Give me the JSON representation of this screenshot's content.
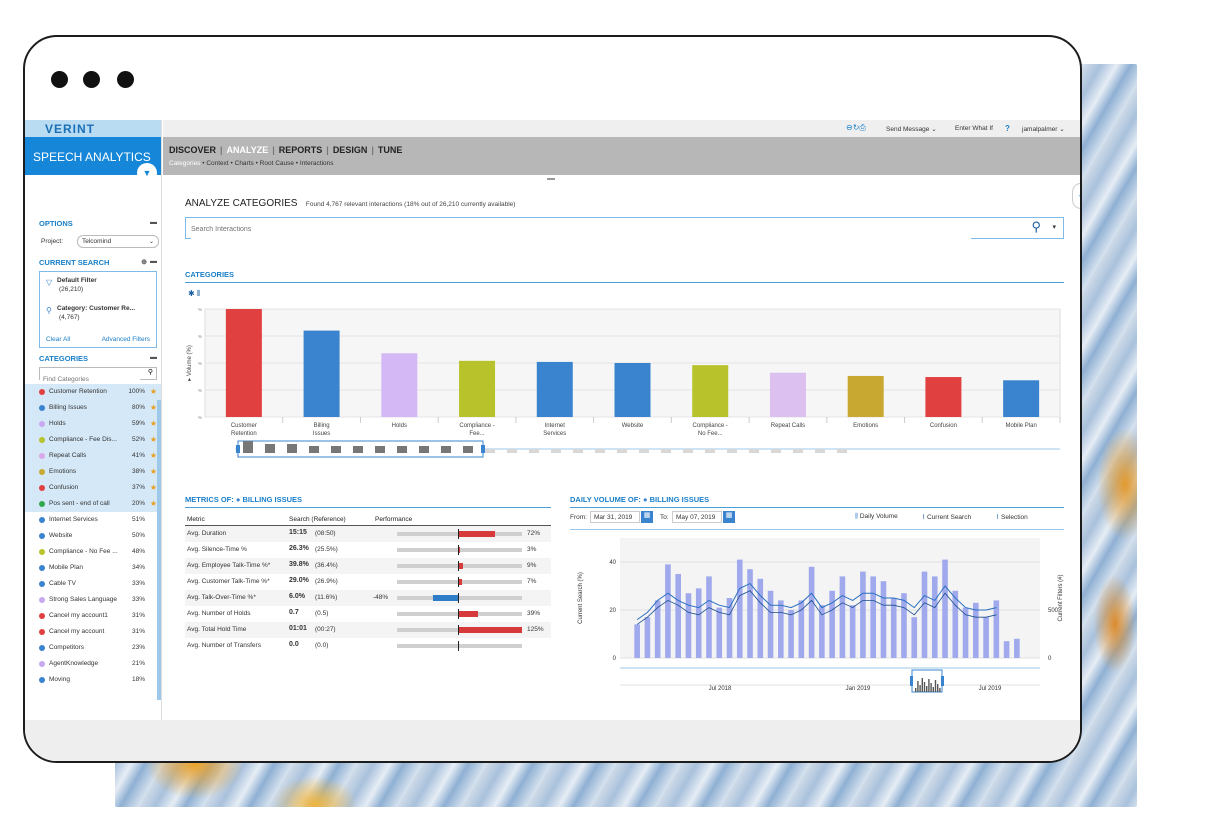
{
  "brand": "VERINT",
  "product": "SPEECH ANALYTICS",
  "topbar": {
    "send_message": "Send Message",
    "enter_what_if": "Enter What If",
    "help": "?",
    "user": "jamalpalmer"
  },
  "nav": {
    "tabs": [
      "DISCOVER",
      "ANALYZE",
      "REPORTS",
      "DESIGN",
      "TUNE"
    ],
    "active_tab": "ANALYZE",
    "subtabs": [
      "Categories",
      "Context",
      "Charts",
      "Root Cause",
      "Interactions"
    ],
    "active_subtab": "Categories"
  },
  "sidebar": {
    "options_title": "OPTIONS",
    "project_label": "Project:",
    "project_value": "Telcomind",
    "current_search_title": "CURRENT SEARCH",
    "filters": [
      {
        "label": "Default Filter",
        "count": "(26,210)"
      },
      {
        "label": "Category: Customer Re...",
        "count": "(4,767)"
      }
    ],
    "clear_all": "Clear All",
    "advanced_filters": "Advanced Filters",
    "categories_title": "CATEGORIES",
    "find_placeholder": "Find Categories",
    "categories": [
      {
        "name": "Customer Retention",
        "pct": "100%",
        "color": "#e04040",
        "selected": true
      },
      {
        "name": "Billing Issues",
        "pct": "80%",
        "color": "#3a84cf",
        "selected": true
      },
      {
        "name": "Holds",
        "pct": "59%",
        "color": "#c9a8f0",
        "selected": true
      },
      {
        "name": "Compliance - Fee Dis...",
        "pct": "52%",
        "color": "#b8c22a",
        "selected": true
      },
      {
        "name": "Repeat Calls",
        "pct": "41%",
        "color": "#d8a8e8",
        "selected": true
      },
      {
        "name": "Emotions",
        "pct": "38%",
        "color": "#c8a830",
        "selected": true
      },
      {
        "name": "Confusion",
        "pct": "37%",
        "color": "#e04040",
        "selected": true
      },
      {
        "name": "Pos sent - end of call",
        "pct": "20%",
        "color": "#2ea84a",
        "selected": true
      },
      {
        "name": "Internet Services",
        "pct": "51%",
        "color": "#3a84cf",
        "selected": false
      },
      {
        "name": "Website",
        "pct": "50%",
        "color": "#3a84cf",
        "selected": false
      },
      {
        "name": "Compliance - No Fee ...",
        "pct": "48%",
        "color": "#b8c22a",
        "selected": false
      },
      {
        "name": "Mobile Plan",
        "pct": "34%",
        "color": "#3a84cf",
        "selected": false
      },
      {
        "name": "Cable TV",
        "pct": "33%",
        "color": "#3a84cf",
        "selected": false
      },
      {
        "name": "Strong Sales Language",
        "pct": "33%",
        "color": "#c9a8f0",
        "selected": false
      },
      {
        "name": "Cancel my account1",
        "pct": "31%",
        "color": "#e04040",
        "selected": false
      },
      {
        "name": "Cancel my account",
        "pct": "31%",
        "color": "#e04040",
        "selected": false
      },
      {
        "name": "Competitors",
        "pct": "23%",
        "color": "#3a84cf",
        "selected": false
      },
      {
        "name": "AgentKnowledge",
        "pct": "21%",
        "color": "#c9a8f0",
        "selected": false
      },
      {
        "name": "Moving",
        "pct": "18%",
        "color": "#3a84cf",
        "selected": false
      }
    ]
  },
  "main": {
    "title": "ANALYZE CATEGORIES",
    "subtitle": "Found 4,767 relevant interactions (18% out of 26,210 currently available)",
    "search_placeholder": "Search Interactions",
    "categories_title": "CATEGORIES",
    "metrics_title": "METRICS OF:",
    "metrics_target": "BILLING ISSUES",
    "metrics_headers": [
      "Metric",
      "Search (Reference)",
      "Performance"
    ],
    "metrics_rows": [
      {
        "metric": "Avg. Duration",
        "value": "15:15",
        "ref": "(08:50)",
        "perf": "72%",
        "perf_val": 72
      },
      {
        "metric": "Avg. Silence-Time %",
        "value": "26.3%",
        "ref": "(25.5%)",
        "perf": "3%",
        "perf_val": 3
      },
      {
        "metric": "Avg. Employee Talk-Time %*",
        "value": "39.8%",
        "ref": "(36.4%)",
        "perf": "9%",
        "perf_val": 9
      },
      {
        "metric": "Avg. Customer Talk-Time %*",
        "value": "29.0%",
        "ref": "(26.9%)",
        "perf": "7%",
        "perf_val": 7
      },
      {
        "metric": "Avg. Talk-Over-Time %*",
        "value": "6.0%",
        "ref": "(11.6%)",
        "perf": "-48%",
        "perf_val": -48
      },
      {
        "metric": "Avg. Number of Holds",
        "value": "0.7",
        "ref": "(0.5)",
        "perf": "39%",
        "perf_val": 39
      },
      {
        "metric": "Avg. Total Hold Time",
        "value": "01:01",
        "ref": "(00:27)",
        "perf": "125%",
        "perf_val": 125
      },
      {
        "metric": "Avg. Number of Transfers",
        "value": "0.0",
        "ref": "(0.0)",
        "perf": "",
        "perf_val": 0
      }
    ],
    "daily_title": "DAILY VOLUME OF:",
    "daily_target": "BILLING ISSUES",
    "from_label": "From:",
    "from_value": "Mar 31, 2019",
    "to_label": "To:",
    "to_value": "May 07, 2019",
    "legend": [
      "Daily Volume",
      "Current Search",
      "Selection"
    ],
    "y_left_label": "Current Search (%)",
    "y_right_label": "Current Filters (#)",
    "timeline_labels": [
      "Jul 2018",
      "Jan 2019",
      "Jul 2019"
    ]
  },
  "chart_data": [
    {
      "type": "bar",
      "title": "CATEGORIES",
      "ylabel": "Volume (%)",
      "categories": [
        "Customer Retention",
        "Billing Issues",
        "Holds",
        "Compliance - Fee...",
        "Internet Services",
        "Website",
        "Compliance - No Fee...",
        "Repeat Calls",
        "Emotions",
        "Confusion",
        "Mobile Plan"
      ],
      "values": [
        100,
        80,
        59,
        52,
        51,
        50,
        48,
        41,
        38,
        37,
        34
      ],
      "colors": [
        "#e04040",
        "#3a84cf",
        "#d3b8f5",
        "#b8c22a",
        "#3a84cf",
        "#3a84cf",
        "#b8c22a",
        "#dcc0f0",
        "#c8a830",
        "#e04040",
        "#3a84cf"
      ],
      "ylim": [
        0,
        100
      ]
    },
    {
      "type": "bar",
      "title": "DAILY VOLUME OF: BILLING ISSUES",
      "ylabel": "Current Search (%)",
      "ylim": [
        0,
        50
      ],
      "y_ticks": [
        0,
        20,
        40
      ],
      "y2_ticks": [
        0,
        500
      ],
      "values": [
        14,
        17,
        24,
        39,
        35,
        27,
        29,
        34,
        21,
        25,
        41,
        37,
        33,
        28,
        24,
        20,
        24,
        38,
        22,
        28,
        34,
        22,
        36,
        34,
        32,
        25,
        27,
        17,
        36,
        34,
        41,
        28,
        21,
        23,
        17,
        24,
        7,
        8
      ],
      "line_current": [
        16,
        19,
        24,
        27,
        24,
        22,
        21,
        24,
        22,
        21,
        29,
        31,
        26,
        22,
        22,
        21,
        23,
        27,
        21,
        23,
        26,
        24,
        27,
        27,
        25,
        25,
        24,
        21,
        26,
        24,
        30,
        25,
        21,
        20,
        20,
        21,
        27,
        23
      ],
      "line_selection": [
        14,
        17,
        21,
        24,
        22,
        19,
        18,
        21,
        19,
        18,
        26,
        28,
        23,
        19,
        19,
        18,
        20,
        24,
        18,
        20,
        23,
        21,
        24,
        24,
        22,
        22,
        21,
        18,
        23,
        21,
        27,
        22,
        18,
        17,
        17,
        18,
        23,
        20
      ]
    }
  ]
}
